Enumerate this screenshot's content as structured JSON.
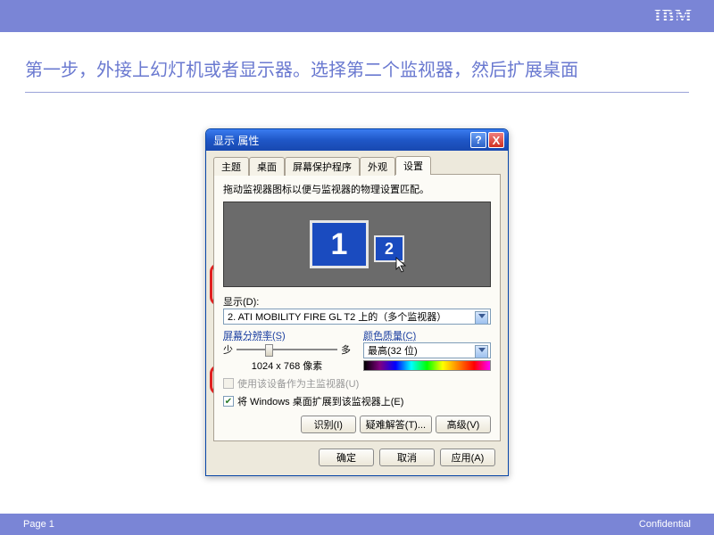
{
  "logo_text": "IBM",
  "heading": "第一步，外接上幻灯机或者显示器。选择第二个监视器，然后扩展桌面",
  "footer": {
    "page": "Page 1",
    "confidential": "Confidential"
  },
  "window": {
    "title": "显示 属性",
    "help_glyph": "?",
    "close_glyph": "X",
    "tabs": [
      "主题",
      "桌面",
      "屏幕保护程序",
      "外观",
      "设置"
    ],
    "active_tab": "设置",
    "drag_hint": "拖动监视器图标以便与监视器的物理设置匹配。",
    "monitor_labels": {
      "one": "1",
      "two": "2"
    },
    "display_label": "显示(D):",
    "display_value": "2. ATI MOBILITY FIRE GL T2 上的（多个监视器）",
    "resolution_label": "屏幕分辨率(S)",
    "res_min": "少",
    "res_max": "多",
    "res_value": "1024 x 768 像素",
    "color_label": "颜色质量(C)",
    "color_value": "最高(32 位)",
    "cb_primary": "使用该设备作为主监视器(U)",
    "cb_extend": "将 Windows 桌面扩展到该监视器上(E)",
    "btn_identify": "识别(I)",
    "btn_troubleshoot": "疑难解答(T)...",
    "btn_advanced": "高级(V)",
    "btn_ok": "确定",
    "btn_cancel": "取消",
    "btn_apply": "应用(A)"
  }
}
